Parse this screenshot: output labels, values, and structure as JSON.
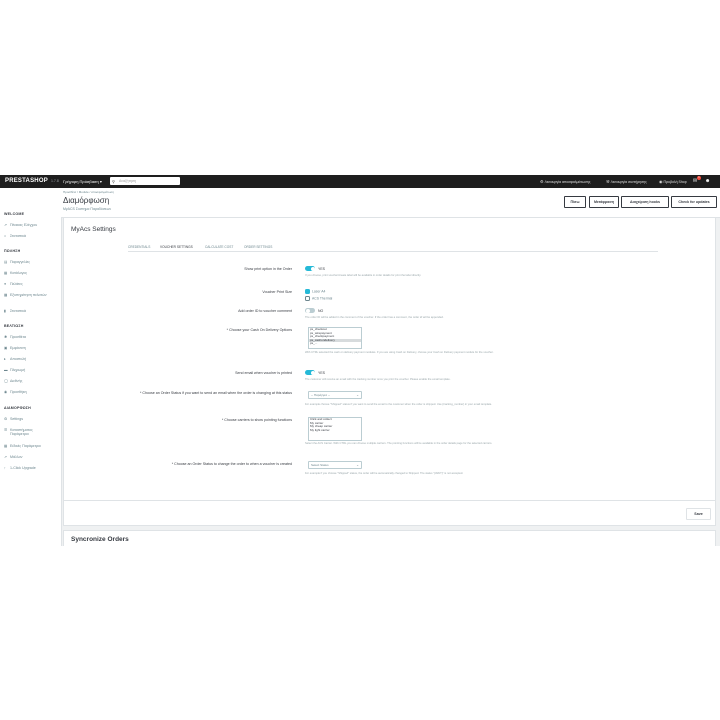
{
  "topbar": {
    "logo": "PRESTASHOP",
    "version": "1.7.8",
    "quick_access": "Γρήγορη Πρόσβαση ▾",
    "search_placeholder": "Αναζήτηση",
    "link1": "Λειτουργία αποσφαλμάτωσης",
    "link2": "Λειτουργία συντήρησης",
    "link3": "Προβολή Shop",
    "badge_count": "1"
  },
  "sidebar": {
    "sec_welcome": "WELCOME",
    "item_dashboard": "Πίνακας Ελέγχου",
    "item_stats": "Στατιστικά",
    "sec_sell": "ΠΩΛΗΣΗ",
    "item_orders": "Παραγγελίες",
    "item_catalog": "Κατάλογος",
    "item_customers": "Πελάτες",
    "item_support": "Εξυπηρέτηση πελατών",
    "item_stats2": "Στατιστικά",
    "sec_improve": "ΒΕΛΤΙΩΣΗ",
    "item_modules": "Προσθέτα",
    "item_design": "Εμφάνιση",
    "item_shipping": "Αποστολή",
    "item_payment": "Πληρωμή",
    "item_intl": "Διεθνής",
    "item_addons": "Προσθήκη",
    "sec_config": "ΔΙΑΜΟΡΦΩΣΗ",
    "item_settings": "Settings",
    "item_shop_params": "Καταστήματος Παράμετροι",
    "item_advanced": "Ειδικές Παράμετροι",
    "item_more": "Μάλλον",
    "item_oneclick": "1-Click Upgrade"
  },
  "header": {
    "breadcrumb": "Προσθέτα  /  Module  /  αποσφαλμάτωση",
    "title": "Διαμόρφωση",
    "subtitle": "MyACS Συστημα Παραδόσεων",
    "btn_back": "Πίσω",
    "btn_translate": "Μετάφραση",
    "btn_manage": "Διαχείριση hooks",
    "btn_updates": "Check for updates"
  },
  "settings": {
    "title": "MyAcs Settings",
    "tabs": [
      "CREDENTIALS",
      "VOUCHER SETTINGS",
      "CALCULATE COST",
      "ORDER SETTINGS"
    ],
    "show_print_label": "Show print option in the Order",
    "show_print_value": "YES",
    "show_print_help": "If you choose, print voucher/create label will be available in order details for print the label directly.",
    "voucher_size_label": "Voucher Print Size",
    "size_options": [
      "Laser A4",
      "ACS Thermal"
    ],
    "add_order_id_label": "Add order ID to voucher comment",
    "add_order_id_value": "NO",
    "add_order_id_help": "The order ID will be added in the comment of the voucher. If the order has a comment, the order id will be appended.",
    "cod_label": "* Choose your Cash On Delivery Options",
    "cod_options": [
      "ps_checkout",
      "ps_wirepayment",
      "ps_checkpayment",
      "ps_cashondelivery",
      "ps_..."
    ],
    "cod_help": "With CTRL selected the cash on delivery payment modules. If you are using Cash on Delivery, choose your Cash on Delivery payment module for the voucher.",
    "email_label": "Send email when voucher is printed",
    "email_value": "YES",
    "email_help": "The customer will receive an email with the tracking number once you print the voucher. Please enable the email template.",
    "status_email_label": "* Choose an Order Status if you want to send an email when the order is changing at this status",
    "status_email_value": "-- Παράγγελ --",
    "status_email_help": "For example choose \"Shipped\" status if you want to send the email to the customer when the order is shipped. Use {tracking_number} in your email template.",
    "carriers_label": "* Choose carriers to show pointing functions",
    "carriers_options": [
      "Click and collect",
      "My carrier",
      "My cheap carrier",
      "My light carrier"
    ],
    "carriers_help": "Select the ACS Carrier. With CTRL you can choose multiple carriers. The pointing functions will be available in the order details page for the selected carriers.",
    "status_created_label": "* Choose an Order Status to change the order to when a voucher is created",
    "status_created_value": "Select Status",
    "status_created_help": "For example if you choose \"Shipped\" status, the order will be automatically changed to Shipped. The status \"{WAIT}\" is not accepted.",
    "save": "Save"
  },
  "sync": {
    "title": "Syncronize Orders"
  }
}
